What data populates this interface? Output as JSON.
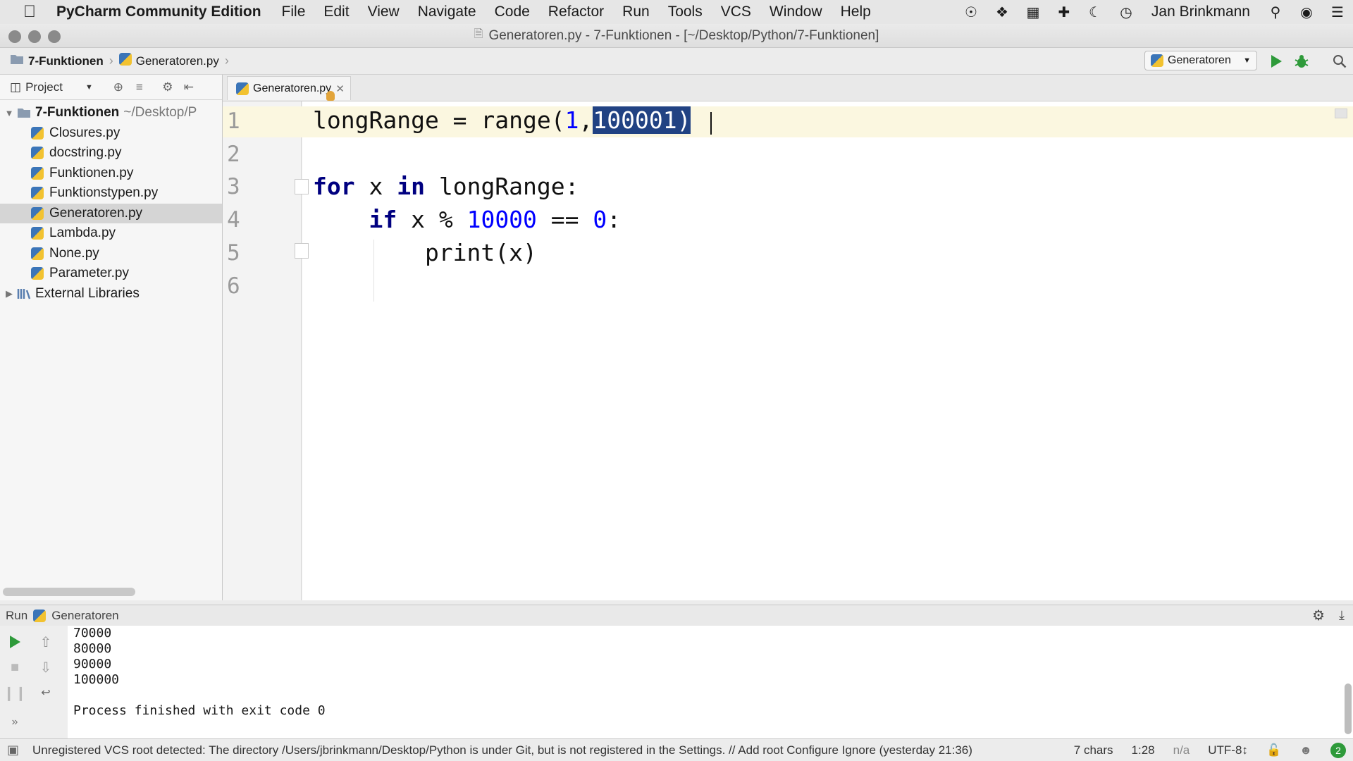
{
  "menubar": {
    "app_name": "PyCharm Community Edition",
    "menus": [
      "File",
      "Edit",
      "View",
      "Navigate",
      "Code",
      "Refactor",
      "Run",
      "Tools",
      "VCS",
      "Window",
      "Help"
    ],
    "user": "Jan Brinkmann"
  },
  "window": {
    "title": "Generatoren.py - 7-Funktionen - [~/Desktop/Python/7-Funktionen]"
  },
  "navbar": {
    "crumbs": [
      "7-Funktionen",
      "Generatoren.py"
    ],
    "run_config": "Generatoren"
  },
  "project": {
    "header_label": "Project",
    "root_name": "7-Funktionen",
    "root_path": "~/Desktop/P",
    "files": [
      "Closures.py",
      "docstring.py",
      "Funktionen.py",
      "Funktionstypen.py",
      "Generatoren.py",
      "Lambda.py",
      "None.py",
      "Parameter.py"
    ],
    "selected_file": "Generatoren.py",
    "external": "External Libraries"
  },
  "editor": {
    "tab_label": "Generatoren.py",
    "line_numbers": [
      "1",
      "2",
      "3",
      "4",
      "5",
      "6"
    ],
    "selected_text": "100001)"
  },
  "run": {
    "label": "Run",
    "config": "Generatoren",
    "output": [
      "70000",
      "80000",
      "90000",
      "100000",
      "",
      "Process finished with exit code 0"
    ]
  },
  "status": {
    "message": "Unregistered VCS root detected: The directory /Users/jbrinkmann/Desktop/Python is under Git, but is not registered in the Settings. // Add root  Configure  Ignore (yesterday 21:36)",
    "chars": "7 chars",
    "position": "1:28",
    "na": "n/a",
    "encoding": "UTF-8↕",
    "notifications": "2"
  },
  "colors": {
    "keyword": "#000080",
    "number": "#0000ff",
    "selection": "#214283",
    "run_green": "#2e9a3a"
  }
}
